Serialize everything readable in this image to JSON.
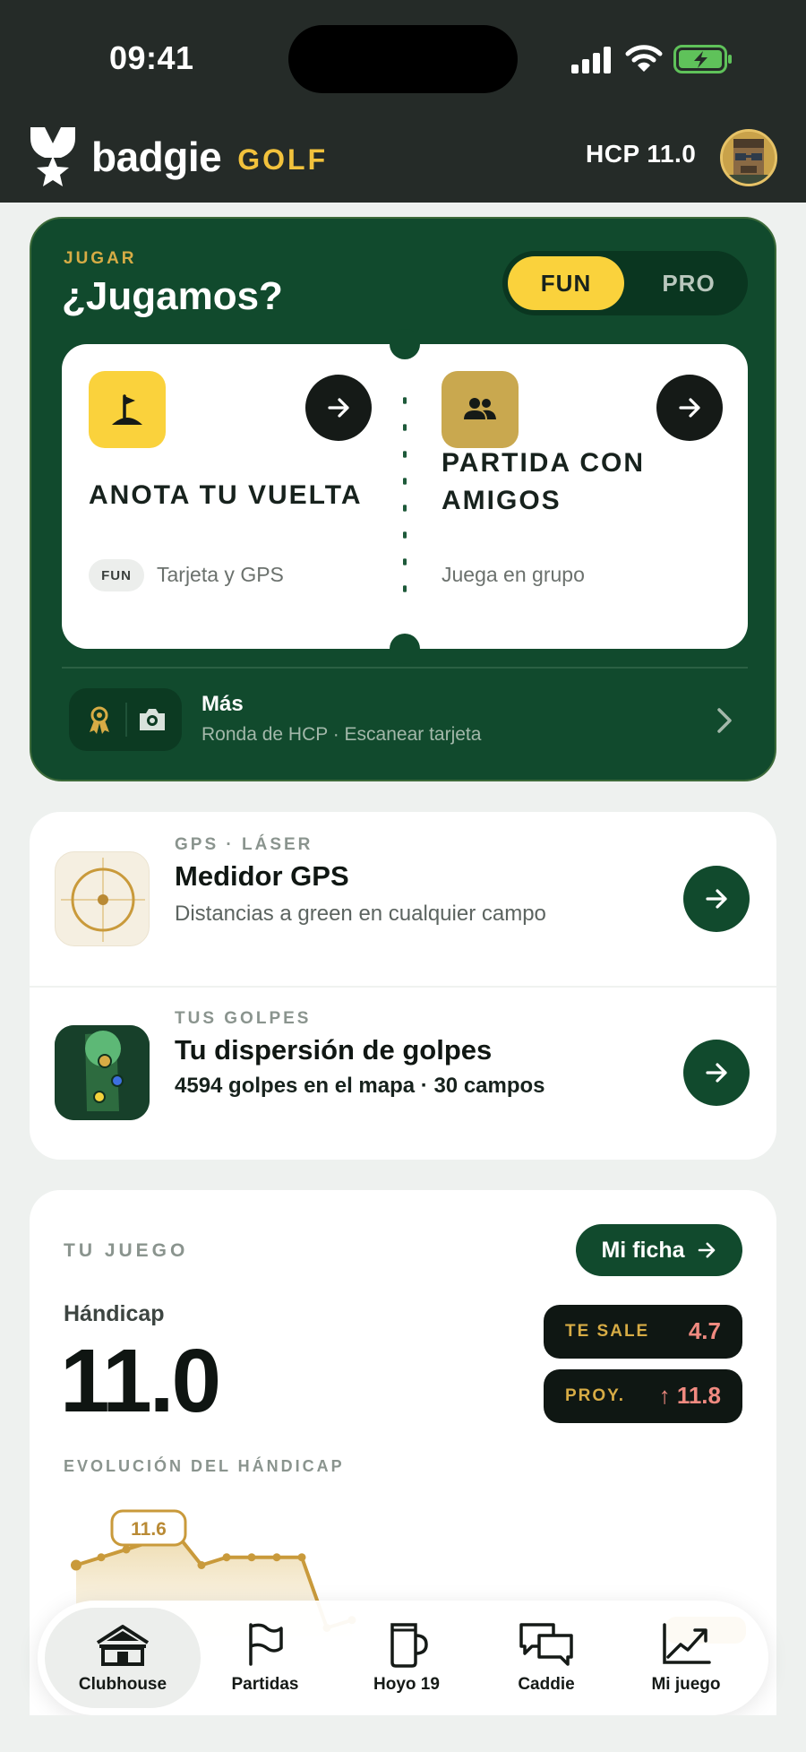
{
  "status_bar": {
    "time": "09:41"
  },
  "header": {
    "brand": "badgie",
    "brand_suffix": "GOLF",
    "hcp": "HCP 11.0"
  },
  "play": {
    "eyebrow": "JUGAR",
    "title": "¿Jugamos?",
    "modes": [
      "FUN",
      "PRO"
    ],
    "selected_mode": "FUN",
    "options": [
      {
        "title": "ANOTA TU VUELTA",
        "badge": "FUN",
        "subtitle": "Tarjeta y GPS",
        "icon": "golf-flag-icon"
      },
      {
        "title": "PARTIDA CON AMIGOS",
        "subtitle": "Juega en grupo",
        "icon": "group-icon"
      }
    ],
    "more": {
      "title": "Más",
      "subtitle": "Ronda de HCP · Escanear tarjeta"
    }
  },
  "tools": [
    {
      "eyebrow": "GPS · LÁSER",
      "title": "Medidor GPS",
      "subtitle": "Distancias a green en cualquier campo",
      "icon": "crosshair-icon"
    },
    {
      "eyebrow": "TUS GOLPES",
      "title": "Tu dispersión de golpes",
      "subtitle": "4594 golpes en el mapa · 30 campos",
      "icon": "shot-map-icon"
    }
  ],
  "game": {
    "eyebrow": "TU JUEGO",
    "ficha_button": "Mi ficha",
    "handicap_label": "Hándicap",
    "handicap_value": "11.0",
    "stats": [
      {
        "label": "TE SALE",
        "value": "4.7"
      },
      {
        "label": "PROY.",
        "value": "↑ 11.8"
      }
    ],
    "evolution_label": "EVOLUCIÓN DEL HÁNDICAP",
    "first_point_label": "11.6"
  },
  "chart_data": {
    "type": "area",
    "values": [
      11.6,
      11.7,
      11.8,
      11.9,
      12.0,
      11.6,
      11.7,
      11.7,
      11.7,
      11.7,
      10.8,
      10.9
    ],
    "title": "",
    "xlabel": "",
    "ylabel": "",
    "ylim": [
      10.6,
      12.2
    ],
    "color": "#c99a3b"
  },
  "tabs": [
    {
      "label": "Clubhouse",
      "icon": "clubhouse-icon",
      "active": true
    },
    {
      "label": "Partidas",
      "icon": "flag-icon",
      "active": false
    },
    {
      "label": "Hoyo 19",
      "icon": "mug-icon",
      "active": false
    },
    {
      "label": "Caddie",
      "icon": "chat-icon",
      "active": false
    },
    {
      "label": "Mi juego",
      "icon": "trend-icon",
      "active": false
    }
  ],
  "colors": {
    "header_bg": "#252b28",
    "brand_green": "#114a2d",
    "accent_yellow": "#fad23c",
    "accent_gold": "#d7ac45",
    "stat_red": "#f08a80"
  }
}
